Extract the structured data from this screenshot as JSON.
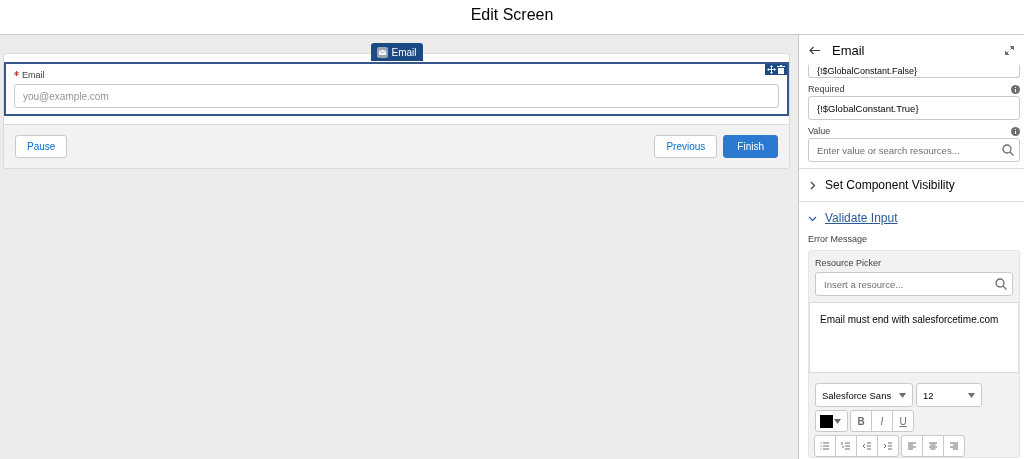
{
  "header": {
    "title": "Edit Screen"
  },
  "canvas": {
    "component_tab": "Email",
    "field": {
      "label": "Email",
      "required": true,
      "placeholder": "you@example.com"
    },
    "buttons": [
      {
        "label": "Pause",
        "kind": "neutral"
      },
      {
        "label": "Previous",
        "kind": "neutral"
      },
      {
        "label": "Finish",
        "kind": "brand"
      }
    ]
  },
  "panel": {
    "title": "Email",
    "fields": [
      {
        "value": "{!$GlobalConstant.False}",
        "info": false
      },
      {
        "label": "Required",
        "value": "{!$GlobalConstant.True}",
        "info": true
      },
      {
        "label": "Value",
        "placeholder": "Enter value or search resources...",
        "info": true,
        "search": true
      }
    ],
    "sections": [
      {
        "title": "Set Component Visibility",
        "expanded": false
      },
      {
        "title": "Validate Input",
        "expanded": true
      }
    ],
    "error_message": {
      "label": "Error Message",
      "picker_label": "Resource Picker",
      "picker_placeholder": "Insert a resource...",
      "text": "Email must end with salesforcetime.com",
      "font": "Salesforce Sans",
      "size": "12",
      "format_buttons": [
        "B",
        "I",
        "U"
      ]
    }
  }
}
